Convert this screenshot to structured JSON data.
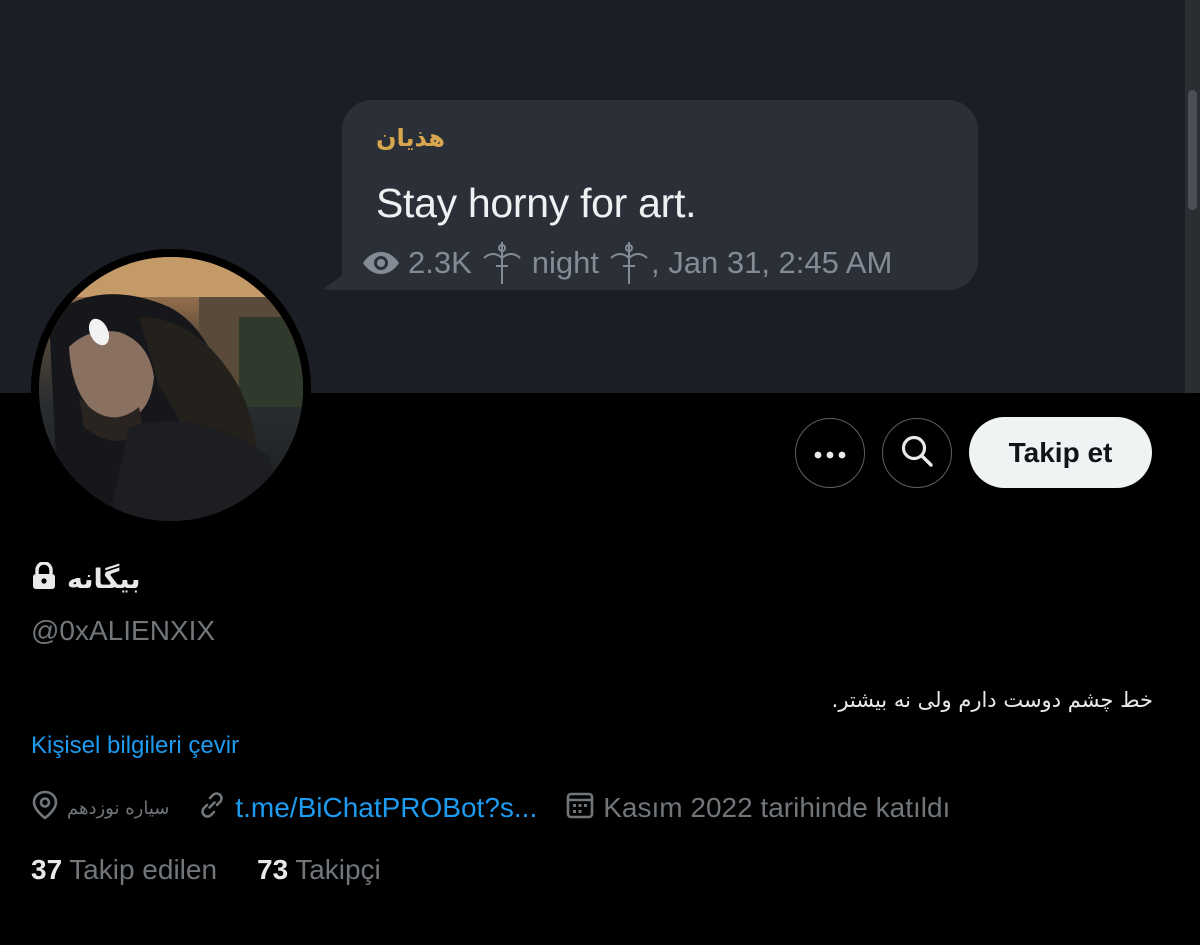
{
  "banner": {
    "sender": "هذیان",
    "message": "Stay horny for art.",
    "views": "2.3K",
    "signature": "night",
    "date": ", Jan 31, 2:45 AM"
  },
  "actions": {
    "more_label": "More",
    "search_label": "Search",
    "follow_label": "Takip et"
  },
  "profile": {
    "display_name": "بیگانه",
    "protected": true,
    "handle": "@0xALIENXIX",
    "bio": "خط چشم دوست دارم ولی نه بیشتر.",
    "translate_label": "Kişisel bilgileri çevir",
    "location": "سیاره نوزدهم",
    "website": "t.me/BiChatPROBot?s...",
    "joined": "Kasım 2022 tarihinde katıldı"
  },
  "stats": {
    "following_count": "37",
    "following_label": "Takip edilen",
    "followers_count": "73",
    "followers_label": "Takipçi"
  },
  "colors": {
    "background": "#000000",
    "banner": "#1b1f25",
    "bubble": "#2b3038",
    "sender_accent": "#d8a64e",
    "link": "#1d9bf0",
    "secondary_text": "#71767b",
    "follow_button": "#eff3f4"
  }
}
